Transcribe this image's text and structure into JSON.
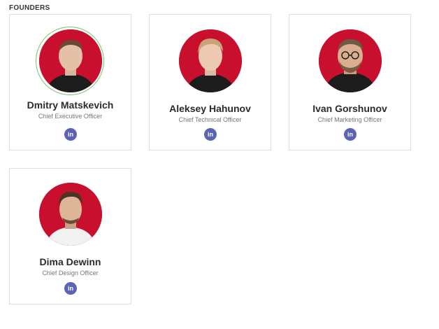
{
  "section": {
    "title": "FOUNDERS"
  },
  "founders": [
    {
      "name": "Dmitry Matskevich",
      "role": "Chief Executive Officer",
      "social_icon": "linkedin-icon",
      "social_label": "in",
      "highlighted": true
    },
    {
      "name": "Aleksey Hahunov",
      "role": "Chief Technical Officer",
      "social_icon": "linkedin-icon",
      "social_label": "in",
      "highlighted": false
    },
    {
      "name": "Ivan Gorshunov",
      "role": "Chief Marketing Officer",
      "social_icon": "linkedin-icon",
      "social_label": "in",
      "highlighted": false
    },
    {
      "name": "Dima Dewinn",
      "role": "Chief Design Officer",
      "social_icon": "linkedin-icon",
      "social_label": "in",
      "highlighted": false
    }
  ],
  "colors": {
    "avatar_background": "#c8102e",
    "linkedin_badge": "#5b63b2",
    "highlight_ring": "#74c46b",
    "card_border": "#e0e0e0"
  }
}
